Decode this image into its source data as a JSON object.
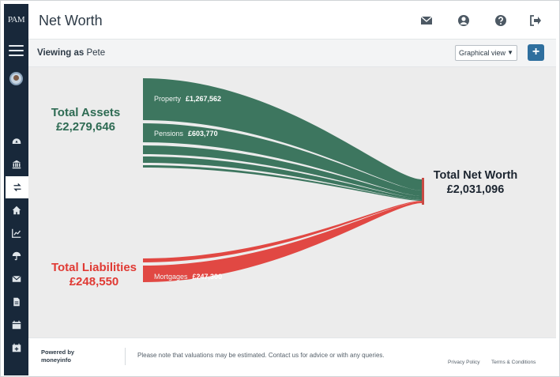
{
  "app": {
    "logo_text": "PAM"
  },
  "header": {
    "title": "Net Worth"
  },
  "header_icons": [
    "envelope-icon",
    "user-circle-icon",
    "question-icon",
    "logout-icon"
  ],
  "subbar": {
    "viewing_label": "Viewing as",
    "viewing_user": "Pete",
    "view_select": "Graphical view",
    "add_button": "+"
  },
  "sidebar": {
    "items": [
      {
        "name": "dashboard",
        "icon": "gauge-icon"
      },
      {
        "name": "bank",
        "icon": "bank-icon"
      },
      {
        "name": "transfers",
        "icon": "transfer-icon",
        "active": true
      },
      {
        "name": "home",
        "icon": "home-icon"
      },
      {
        "name": "investments",
        "icon": "chart-line-icon"
      },
      {
        "name": "insurance",
        "icon": "umbrella-icon"
      },
      {
        "name": "messages",
        "icon": "envelope-icon"
      },
      {
        "name": "documents",
        "icon": "file-icon"
      },
      {
        "name": "calendar",
        "icon": "calendar-icon"
      },
      {
        "name": "add-calendar",
        "icon": "calendar-plus-icon"
      }
    ]
  },
  "chart_data": {
    "type": "sankey",
    "assets": {
      "label": "Total Assets",
      "value": "£2,279,646"
    },
    "liabilities": {
      "label": "Total Liabilities",
      "value": "£248,550"
    },
    "net": {
      "label": "Total Net Worth",
      "value": "£2,031,096"
    },
    "asset_flows": [
      {
        "name": "Property",
        "value": "£1,267,562"
      },
      {
        "name": "Pensions",
        "value": "£603,770"
      },
      {
        "name": "",
        "value": ""
      },
      {
        "name": "",
        "value": ""
      },
      {
        "name": "",
        "value": ""
      }
    ],
    "liability_flows": [
      {
        "name": "",
        "value": ""
      },
      {
        "name": "Mortgages",
        "value": "£247,300"
      }
    ],
    "colors": {
      "assets": "#2e6b53",
      "liabilities": "#e03a34"
    }
  },
  "footer": {
    "powered_line1": "Powered by",
    "powered_line2": "moneyinfo",
    "notice": "Please note that valuations may be estimated. Contact us for advice or with any queries.",
    "privacy": "Privacy Policy",
    "terms": "Terms & Conditions"
  }
}
